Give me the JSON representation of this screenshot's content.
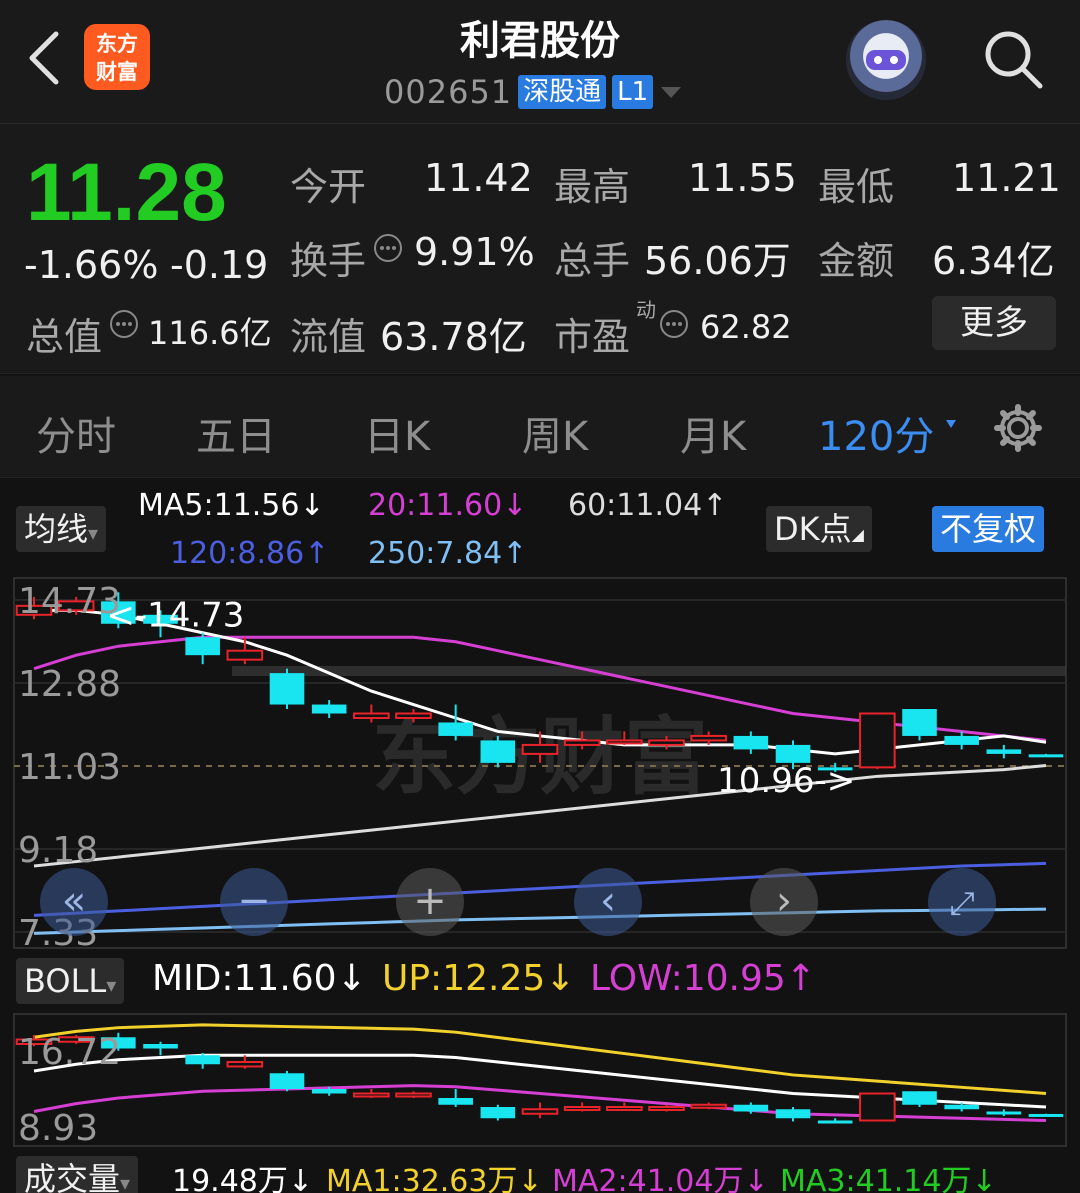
{
  "header": {
    "logo_line1": "东方",
    "logo_line2": "财富",
    "stock_name": "利君股份",
    "stock_code": "002651",
    "tag_connect": "深股通",
    "tag_level": "L1"
  },
  "quote": {
    "price": "11.28",
    "change_pct": "-1.66%",
    "change_amt": "-0.19",
    "open_label": "今开",
    "open": "11.42",
    "high_label": "最高",
    "high": "11.55",
    "low_label": "最低",
    "low": "11.21",
    "turnover_label": "换手",
    "turnover": "9.91%",
    "volume_label": "总手",
    "volume": "56.06万",
    "amount_label": "金额",
    "amount": "6.34亿",
    "mktcap_label": "总值",
    "mktcap": "116.6亿",
    "float_label": "流值",
    "float_cap": "63.78亿",
    "pe_label": "市盈",
    "pe_sup": "动",
    "pe": "62.82",
    "more_label": "更多",
    "colors": {
      "up": "#e8232a",
      "down": "#22cc22"
    }
  },
  "tabs": {
    "items": [
      "分时",
      "五日",
      "日K",
      "周K",
      "月K",
      "120分"
    ],
    "active": "120分"
  },
  "ma_bar": {
    "selector": "均线",
    "ma5": "MA5:11.56↓",
    "ma20": "20:11.60↓",
    "ma60": "60:11.04↑",
    "ma120": "120:8.86↑",
    "ma250": "250:7.84↑",
    "dk_label": "DK点",
    "adjust_label": "不复权"
  },
  "price_axis": [
    "14.73",
    "12.88",
    "11.03",
    "9.18",
    "7.33"
  ],
  "annotations": {
    "high_marker": "<-14.73",
    "low_marker": "10.96->"
  },
  "watermark": "东方财富",
  "boll_bar": {
    "selector": "BOLL",
    "mid": "MID:11.60↓",
    "up": "UP:12.25↓",
    "low": "LOW:10.95↑"
  },
  "boll_axis": [
    "16.72",
    "8.93"
  ],
  "volume_bar": {
    "selector": "成交量",
    "vol": "19.48万↓",
    "ma1": "MA1:32.63万↓",
    "ma2": "MA2:41.04万↓",
    "ma3": "MA3:41.14万↓"
  },
  "chart_data": {
    "type": "candlestick",
    "y_range": [
      7.33,
      14.73
    ],
    "candles": [
      {
        "o": 14.4,
        "c": 14.6,
        "h": 14.8,
        "l": 14.3,
        "up": true
      },
      {
        "o": 14.5,
        "c": 14.7,
        "h": 14.8,
        "l": 14.4,
        "up": true
      },
      {
        "o": 14.7,
        "c": 14.2,
        "h": 14.9,
        "l": 14.1,
        "up": false
      },
      {
        "o": 14.4,
        "c": 14.2,
        "h": 14.5,
        "l": 13.9,
        "up": false
      },
      {
        "o": 13.9,
        "c": 13.5,
        "h": 14.0,
        "l": 13.3,
        "up": false
      },
      {
        "o": 13.4,
        "c": 13.6,
        "h": 13.9,
        "l": 13.3,
        "up": true
      },
      {
        "o": 13.1,
        "c": 12.4,
        "h": 13.2,
        "l": 12.3,
        "up": false
      },
      {
        "o": 12.4,
        "c": 12.2,
        "h": 12.5,
        "l": 12.1,
        "up": false
      },
      {
        "o": 12.1,
        "c": 12.2,
        "h": 12.4,
        "l": 12.0,
        "up": true
      },
      {
        "o": 12.1,
        "c": 12.2,
        "h": 12.3,
        "l": 12.0,
        "up": true
      },
      {
        "o": 12.0,
        "c": 11.7,
        "h": 12.4,
        "l": 11.6,
        "up": false
      },
      {
        "o": 11.6,
        "c": 11.1,
        "h": 11.7,
        "l": 11.0,
        "up": false
      },
      {
        "o": 11.3,
        "c": 11.5,
        "h": 11.8,
        "l": 11.1,
        "up": true
      },
      {
        "o": 11.5,
        "c": 11.6,
        "h": 11.8,
        "l": 11.4,
        "up": true
      },
      {
        "o": 11.6,
        "c": 11.6,
        "h": 11.8,
        "l": 11.5,
        "up": true
      },
      {
        "o": 11.5,
        "c": 11.6,
        "h": 11.7,
        "l": 11.4,
        "up": true
      },
      {
        "o": 11.6,
        "c": 11.7,
        "h": 11.8,
        "l": 11.5,
        "up": true
      },
      {
        "o": 11.7,
        "c": 11.4,
        "h": 11.8,
        "l": 11.3,
        "up": false
      },
      {
        "o": 11.5,
        "c": 11.1,
        "h": 11.6,
        "l": 10.96,
        "up": false
      },
      {
        "o": 11.0,
        "c": 10.95,
        "h": 11.1,
        "l": 10.9,
        "up": false
      },
      {
        "o": 11.0,
        "c": 12.2,
        "h": 12.2,
        "l": 10.96,
        "up": true
      },
      {
        "o": 12.3,
        "c": 11.7,
        "h": 12.3,
        "l": 11.6,
        "up": false
      },
      {
        "o": 11.7,
        "c": 11.5,
        "h": 11.8,
        "l": 11.4,
        "up": false
      },
      {
        "o": 11.4,
        "c": 11.3,
        "h": 11.5,
        "l": 11.2,
        "up": false
      },
      {
        "o": 11.29,
        "c": 11.28,
        "h": 11.3,
        "l": 11.25,
        "up": false
      }
    ],
    "ma5": [
      14.5,
      14.5,
      14.4,
      14.2,
      14.0,
      13.8,
      13.5,
      13.1,
      12.7,
      12.4,
      12.1,
      11.8,
      11.7,
      11.6,
      11.5,
      11.5,
      11.5,
      11.5,
      11.4,
      11.3,
      11.4,
      11.5,
      11.6,
      11.7,
      11.56
    ],
    "ma20": [
      13.2,
      13.5,
      13.7,
      13.8,
      13.9,
      13.9,
      13.9,
      13.9,
      13.9,
      13.9,
      13.8,
      13.6,
      13.4,
      13.2,
      13.0,
      12.8,
      12.6,
      12.4,
      12.2,
      12.1,
      12.0,
      11.9,
      11.8,
      11.7,
      11.6
    ],
    "ma60": [
      8.8,
      8.9,
      9.0,
      9.1,
      9.2,
      9.3,
      9.4,
      9.5,
      9.6,
      9.7,
      9.8,
      9.9,
      10.0,
      10.1,
      10.2,
      10.3,
      10.4,
      10.5,
      10.6,
      10.7,
      10.8,
      10.85,
      10.9,
      10.95,
      11.04
    ],
    "ma120": [
      7.7,
      7.75,
      7.8,
      7.85,
      7.9,
      7.95,
      8.0,
      8.05,
      8.1,
      8.15,
      8.2,
      8.25,
      8.3,
      8.35,
      8.4,
      8.45,
      8.5,
      8.55,
      8.6,
      8.65,
      8.7,
      8.75,
      8.8,
      8.83,
      8.86
    ],
    "ma250": [
      7.3,
      7.33,
      7.36,
      7.39,
      7.42,
      7.45,
      7.48,
      7.51,
      7.54,
      7.57,
      7.6,
      7.62,
      7.64,
      7.66,
      7.68,
      7.7,
      7.72,
      7.74,
      7.76,
      7.78,
      7.8,
      7.81,
      7.82,
      7.83,
      7.84
    ]
  }
}
